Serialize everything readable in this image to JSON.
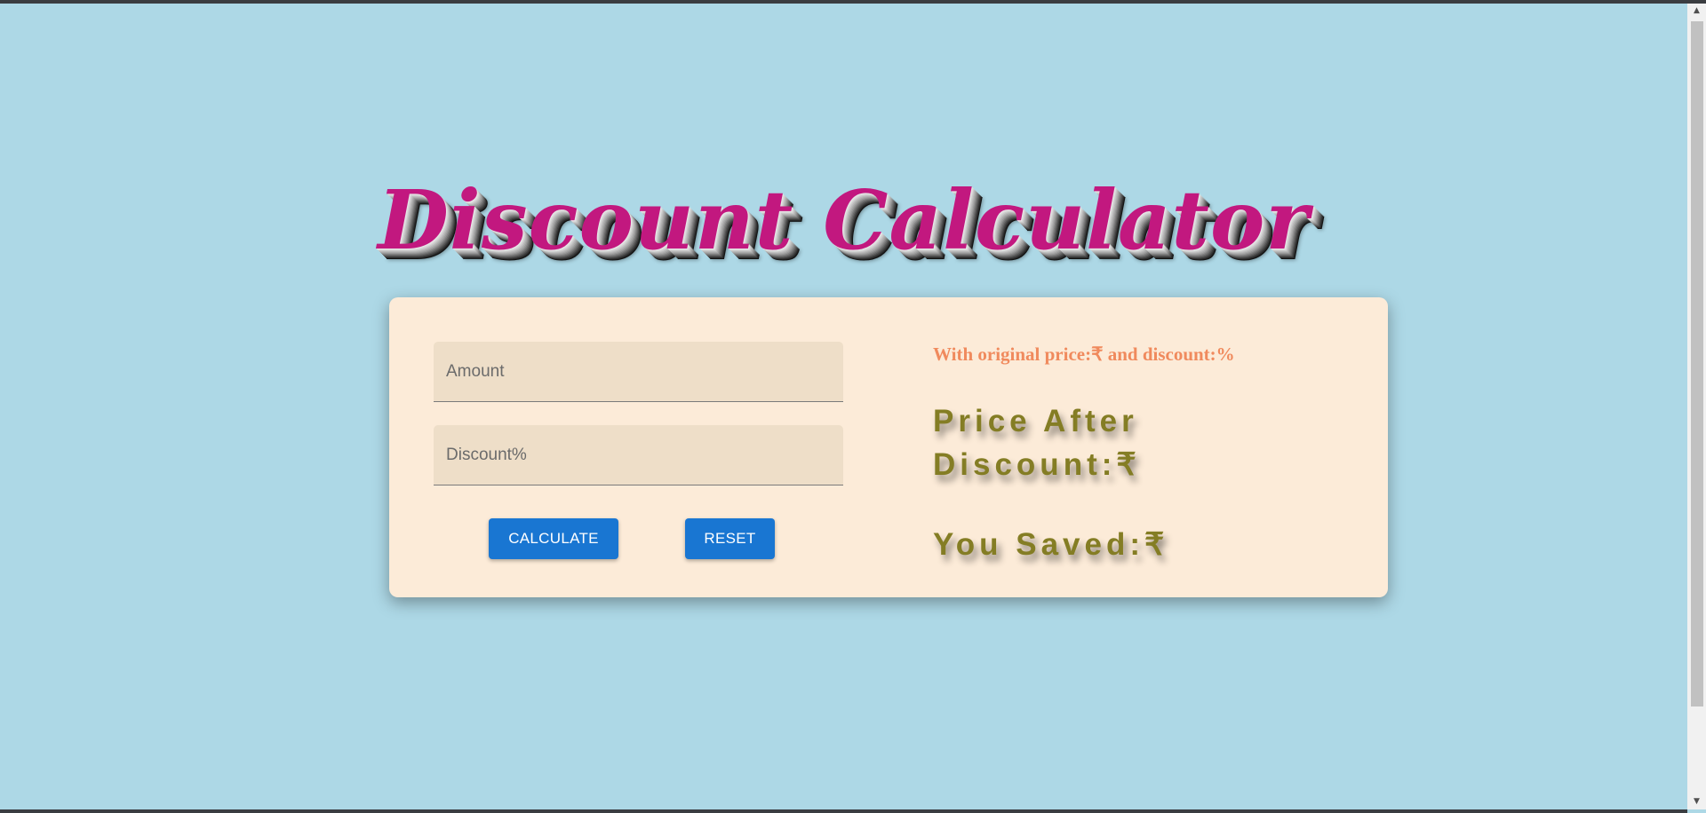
{
  "page": {
    "title": "Discount Calculator"
  },
  "form": {
    "amount_placeholder": "Amount",
    "amount_value": "",
    "discount_placeholder": "Discount%",
    "discount_value": "",
    "calculate_label": "CALCULATE",
    "reset_label": "RESET"
  },
  "results": {
    "summary": "With original price:₹ and discount:%",
    "price_after_discount": "Price After Discount:₹",
    "you_saved": "You Saved:₹"
  },
  "scrollbar": {
    "up_icon": "scroll-up-arrow-icon",
    "down_icon": "scroll-down-arrow-icon"
  },
  "colors": {
    "background": "#ADD8E6",
    "title": "#C2187F",
    "card": "#FCEBD8",
    "field": "#EEDEC8",
    "button": "#1976D2",
    "summary_text": "#F08A5D",
    "result_text": "#847D24"
  }
}
